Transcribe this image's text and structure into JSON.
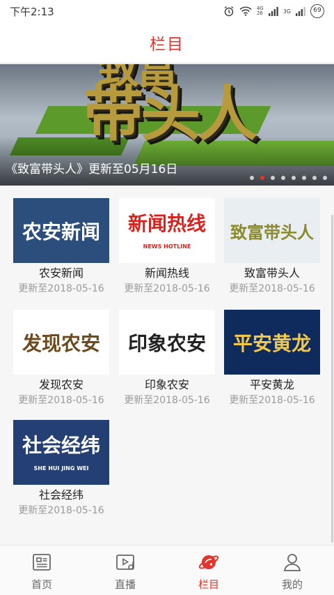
{
  "status": {
    "time": "下午2:13",
    "net_top": "4G",
    "net_bottom": "26",
    "net_3g": "3G",
    "battery": "69"
  },
  "header": {
    "title": "栏目"
  },
  "banner": {
    "caption": "《致富带头人》更新至05月16日",
    "art_text": "带头人",
    "art_text_top": "致富",
    "dot_count": 8,
    "active_dot": 1
  },
  "programs": [
    {
      "title": "农安新闻",
      "date": "更新至2018-05-16",
      "thumb_text": "农安新闻",
      "colors": {
        "bg": "#2b4e7c",
        "fg": "#ffffff"
      }
    },
    {
      "title": "新闻热线",
      "date": "更新至2018-05-16",
      "thumb_text": "新闻热线",
      "thumb_sub": "NEWS HOTLINE",
      "colors": {
        "bg": "#ffffff",
        "fg": "#d8221d"
      }
    },
    {
      "title": "致富带头人",
      "date": "更新至2018-05-16",
      "thumb_text": "致富带头人",
      "colors": {
        "bg": "#e9eef2",
        "fg": "#8a8a2a"
      }
    },
    {
      "title": "发现农安",
      "date": "更新至2018-05-16",
      "thumb_text": "发现农安",
      "colors": {
        "bg": "#ffffff",
        "fg": "#6b4a1e"
      }
    },
    {
      "title": "印象农安",
      "date": "更新至2018-05-16",
      "thumb_text": "印象农安",
      "colors": {
        "bg": "#ffffff",
        "fg": "#222222"
      }
    },
    {
      "title": "平安黄龙",
      "date": "更新至2018-05-16",
      "thumb_text": "平安黄龙",
      "colors": {
        "bg": "#0f2a5c",
        "fg": "#f2c84a"
      }
    },
    {
      "title": "社会经纬",
      "date": "更新至2018-05-16",
      "thumb_text": "社会经纬",
      "thumb_sub": "SHE HUI JING WEI",
      "colors": {
        "bg": "#233f73",
        "fg": "#ffffff"
      }
    }
  ],
  "tabs": [
    {
      "label": "首页",
      "icon": "news-icon",
      "active": false
    },
    {
      "label": "直播",
      "icon": "live-icon",
      "active": false
    },
    {
      "label": "栏目",
      "icon": "planet-icon",
      "active": true
    },
    {
      "label": "我的",
      "icon": "user-icon",
      "active": false
    }
  ],
  "colors": {
    "accent": "#e5342c"
  }
}
